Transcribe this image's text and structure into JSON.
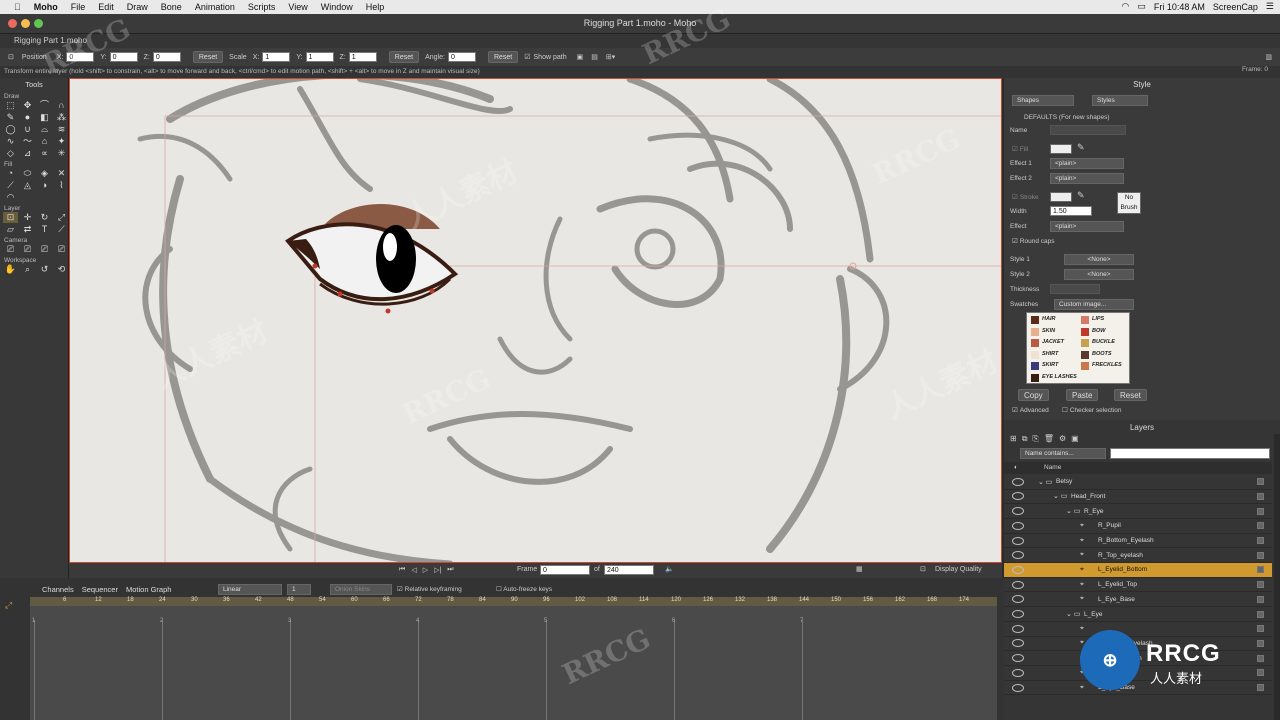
{
  "menubar": {
    "app": "Moho",
    "items": [
      "File",
      "Edit",
      "Draw",
      "Bone",
      "Animation",
      "Scripts",
      "View",
      "Window",
      "Help"
    ],
    "clock": "Fri 10:48 AM",
    "screencap": "ScreenCap"
  },
  "window": {
    "title": "Rigging Part 1.moho - Moho",
    "doc_tab": "Rigging Part 1.moho"
  },
  "tool_options": {
    "position_label": "Position",
    "x_label": "X:",
    "x": "0",
    "y_label": "Y:",
    "y": "0",
    "z_label": "Z:",
    "z": "0",
    "reset1": "Reset",
    "scale_label": "Scale",
    "sx": "1",
    "sy": "1",
    "sz": "1",
    "reset2": "Reset",
    "angle_label": "Angle:",
    "angle": "0",
    "reset3": "Reset",
    "show_path": "Show path"
  },
  "status": {
    "hint": "Transform entire layer (hold <shift> to constrain, <alt> to move forward and back, <ctrl/cmd> to edit motion path, <shift> + <alt> to move in Z and maintain visual size)",
    "frame": "Frame: 0"
  },
  "tools": {
    "title": "Tools",
    "sections": [
      "Draw",
      "Fill",
      "Layer",
      "Camera",
      "Workspace"
    ]
  },
  "style_panel": {
    "title": "Style",
    "shapes": "Shapes",
    "styles": "Styles",
    "defaults": "DEFAULTS (For new shapes)",
    "name_label": "Name",
    "fill": "Fill",
    "effect1": "Effect 1",
    "effect2": "Effect 2",
    "plain": "<plain>",
    "stroke": "Stroke",
    "width": "Width",
    "width_value": "1.50",
    "effect": "Effect",
    "no_brush": "No Brush",
    "round_caps": "Round caps",
    "style1": "Style 1",
    "style2": "Style 2",
    "none": "<None>",
    "thickness": "Thickness",
    "swatches": "Swatches",
    "custom_image": "Custom image...",
    "swatch_labels": [
      "HAIR",
      "LIPS",
      "SKIN",
      "BOW",
      "JACKET",
      "BUCKLE",
      "SHIRT",
      "BOOTS",
      "SKIRT",
      "FRECKLES",
      "EYE LASHES"
    ],
    "copy": "Copy",
    "paste": "Paste",
    "reset": "Reset",
    "advanced": "Advanced",
    "checker": "Checker selection"
  },
  "layers_panel": {
    "title": "Layers",
    "filter": "Name contains...",
    "name_header": "Name",
    "rows": [
      {
        "name": "Betsy"
      },
      {
        "name": "Head_Front"
      },
      {
        "name": "R_Eye"
      },
      {
        "name": "R_Pupil"
      },
      {
        "name": "R_Bottom_Eyelash"
      },
      {
        "name": "R_Top_eyelash"
      },
      {
        "name": "L_Eyelid_Bottom"
      },
      {
        "name": "L_Eyelid_Top"
      },
      {
        "name": "L_Eye_Base"
      },
      {
        "name": "L_Eye"
      },
      {
        "name": ""
      },
      {
        "name": "L_Bottom_Eyelash"
      },
      {
        "name": "L_Top_eyelash"
      },
      {
        "name": ""
      },
      {
        "name": "L_Eye_Base"
      }
    ]
  },
  "transport": {
    "frame_label": "Frame",
    "frame": "0",
    "of": "of",
    "total": "240",
    "display_quality": "Display Quality"
  },
  "timeline": {
    "tabs": [
      "Channels",
      "Sequencer",
      "Motion Graph"
    ],
    "interp": "Linear",
    "step": "1",
    "onion": "Onion Skins",
    "relative": "Relative keyframing",
    "autofreeze": "Auto-freeze keys",
    "ticks": [
      "6",
      "12",
      "18",
      "24",
      "30",
      "36",
      "42",
      "48",
      "54",
      "60",
      "66",
      "72",
      "78",
      "84",
      "90",
      "96",
      "102",
      "108",
      "114",
      "120",
      "126",
      "132",
      "138",
      "144",
      "150",
      "156",
      "162",
      "168",
      "174"
    ],
    "markers": [
      "1",
      "2",
      "3",
      "4",
      "5",
      "6",
      "7"
    ]
  },
  "watermarks": [
    "RRCG",
    "人人素材",
    "RRCG",
    "人人素材",
    "RRCG",
    "RRCG",
    "人人素材",
    "RRCG"
  ],
  "logo": {
    "main": "RRCG",
    "sub": "人人素材"
  },
  "colors": {
    "accent": "#d19a2e",
    "canvas_border": "#c64b2e",
    "eye_outline": "#3a1d12",
    "brow": "#8a5a44"
  }
}
